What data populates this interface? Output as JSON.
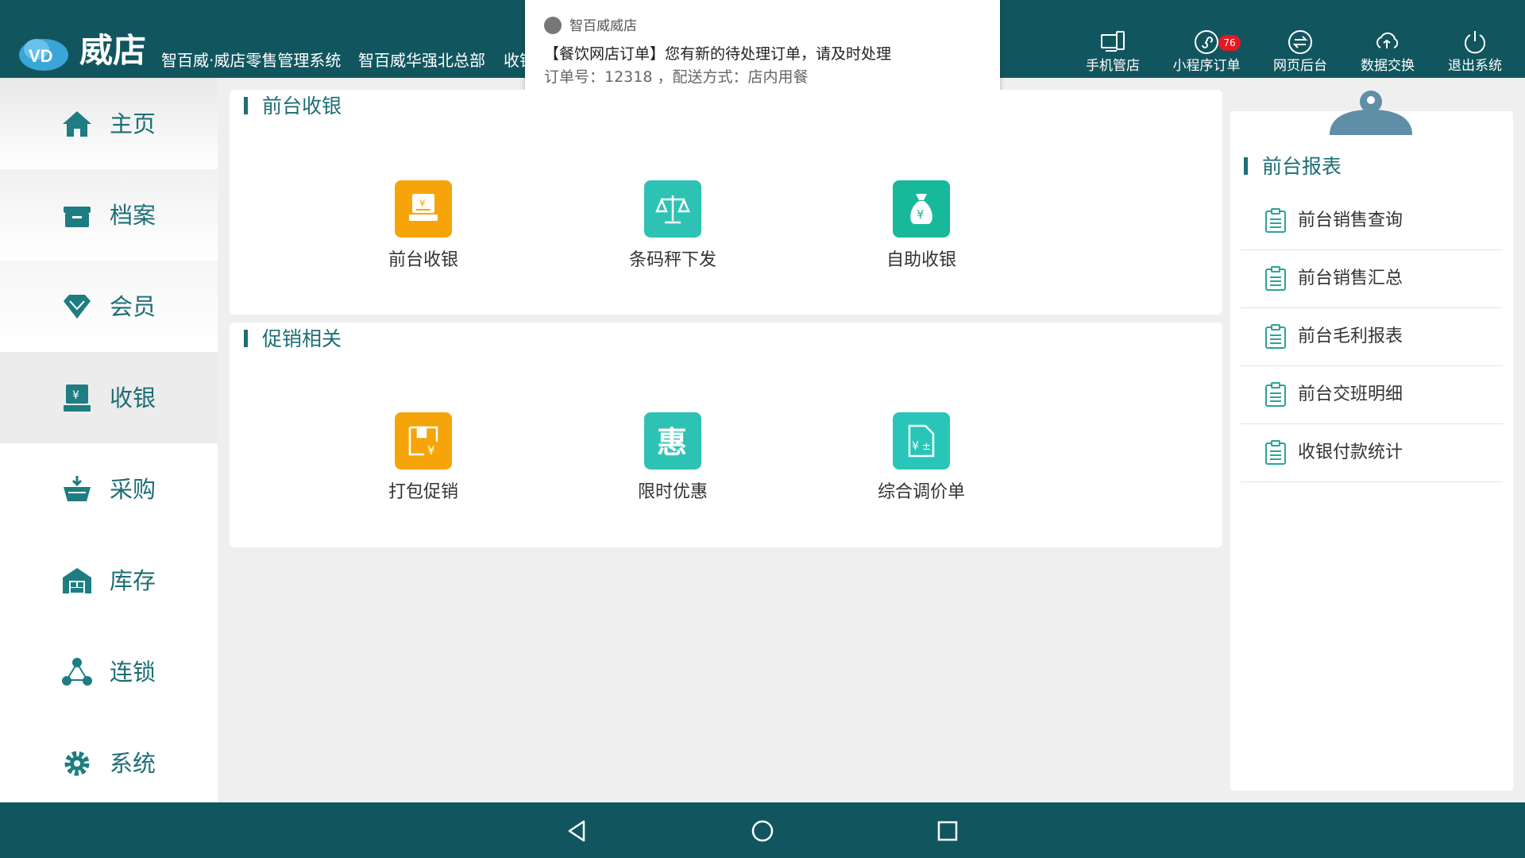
{
  "header": {
    "brand": "威店",
    "subtitle1": "智百威·威店零售管理系统",
    "subtitle2": "智百威华强北总部",
    "subtitle3": "收银",
    "buttons": [
      {
        "label": "手机管店",
        "icon": "mobile-store-icon"
      },
      {
        "label": "小程序订单",
        "icon": "mini-program-icon",
        "badge": "76"
      },
      {
        "label": "网页后台",
        "icon": "web-backend-icon"
      },
      {
        "label": "数据交换",
        "icon": "data-exchange-icon"
      },
      {
        "label": "退出系统",
        "icon": "power-icon"
      }
    ]
  },
  "notification": {
    "app": "智百威威店",
    "title": "【餐饮网店订单】您有新的待处理订单，请及时处理",
    "body": "订单号：12318 ，配送方式：店内用餐"
  },
  "sidebar": {
    "items": [
      {
        "label": "主页",
        "icon": "home-icon"
      },
      {
        "label": "档案",
        "icon": "archive-icon"
      },
      {
        "label": "会员",
        "icon": "member-diamond-icon"
      },
      {
        "label": "收银",
        "icon": "cashier-icon",
        "active": true
      },
      {
        "label": "采购",
        "icon": "purchase-basket-icon"
      },
      {
        "label": "库存",
        "icon": "warehouse-icon"
      },
      {
        "label": "连锁",
        "icon": "chain-network-icon"
      },
      {
        "label": "系统",
        "icon": "system-gear-icon"
      }
    ]
  },
  "sections": [
    {
      "title": "前台收银",
      "tiles": [
        {
          "label": "前台收银",
          "icon": "cash-register-icon",
          "color": "#f5a50a"
        },
        {
          "label": "条码秤下发",
          "icon": "scale-icon",
          "color": "#2ec2b4"
        },
        {
          "label": "自助收银",
          "icon": "money-bag-icon",
          "color": "#18b99a"
        }
      ]
    },
    {
      "title": "促销相关",
      "tiles": [
        {
          "label": "打包促销",
          "icon": "package-promo-icon",
          "color": "#f5a50a"
        },
        {
          "label": "限时优惠",
          "icon": "hui-discount-icon",
          "color": "#2ec2b4"
        },
        {
          "label": "综合调价单",
          "icon": "price-adjust-icon",
          "color": "#29c5b8"
        }
      ]
    }
  ],
  "reports": {
    "title": "前台报表",
    "items": [
      "前台销售查询",
      "前台销售汇总",
      "前台毛利报表",
      "前台交班明细",
      "收银付款统计"
    ]
  },
  "colors": {
    "header_bg": "#11565f",
    "accent": "#1d6e75",
    "orange": "#f5a50a",
    "teal": "#2ec2b4",
    "badge": "#e21b23"
  }
}
